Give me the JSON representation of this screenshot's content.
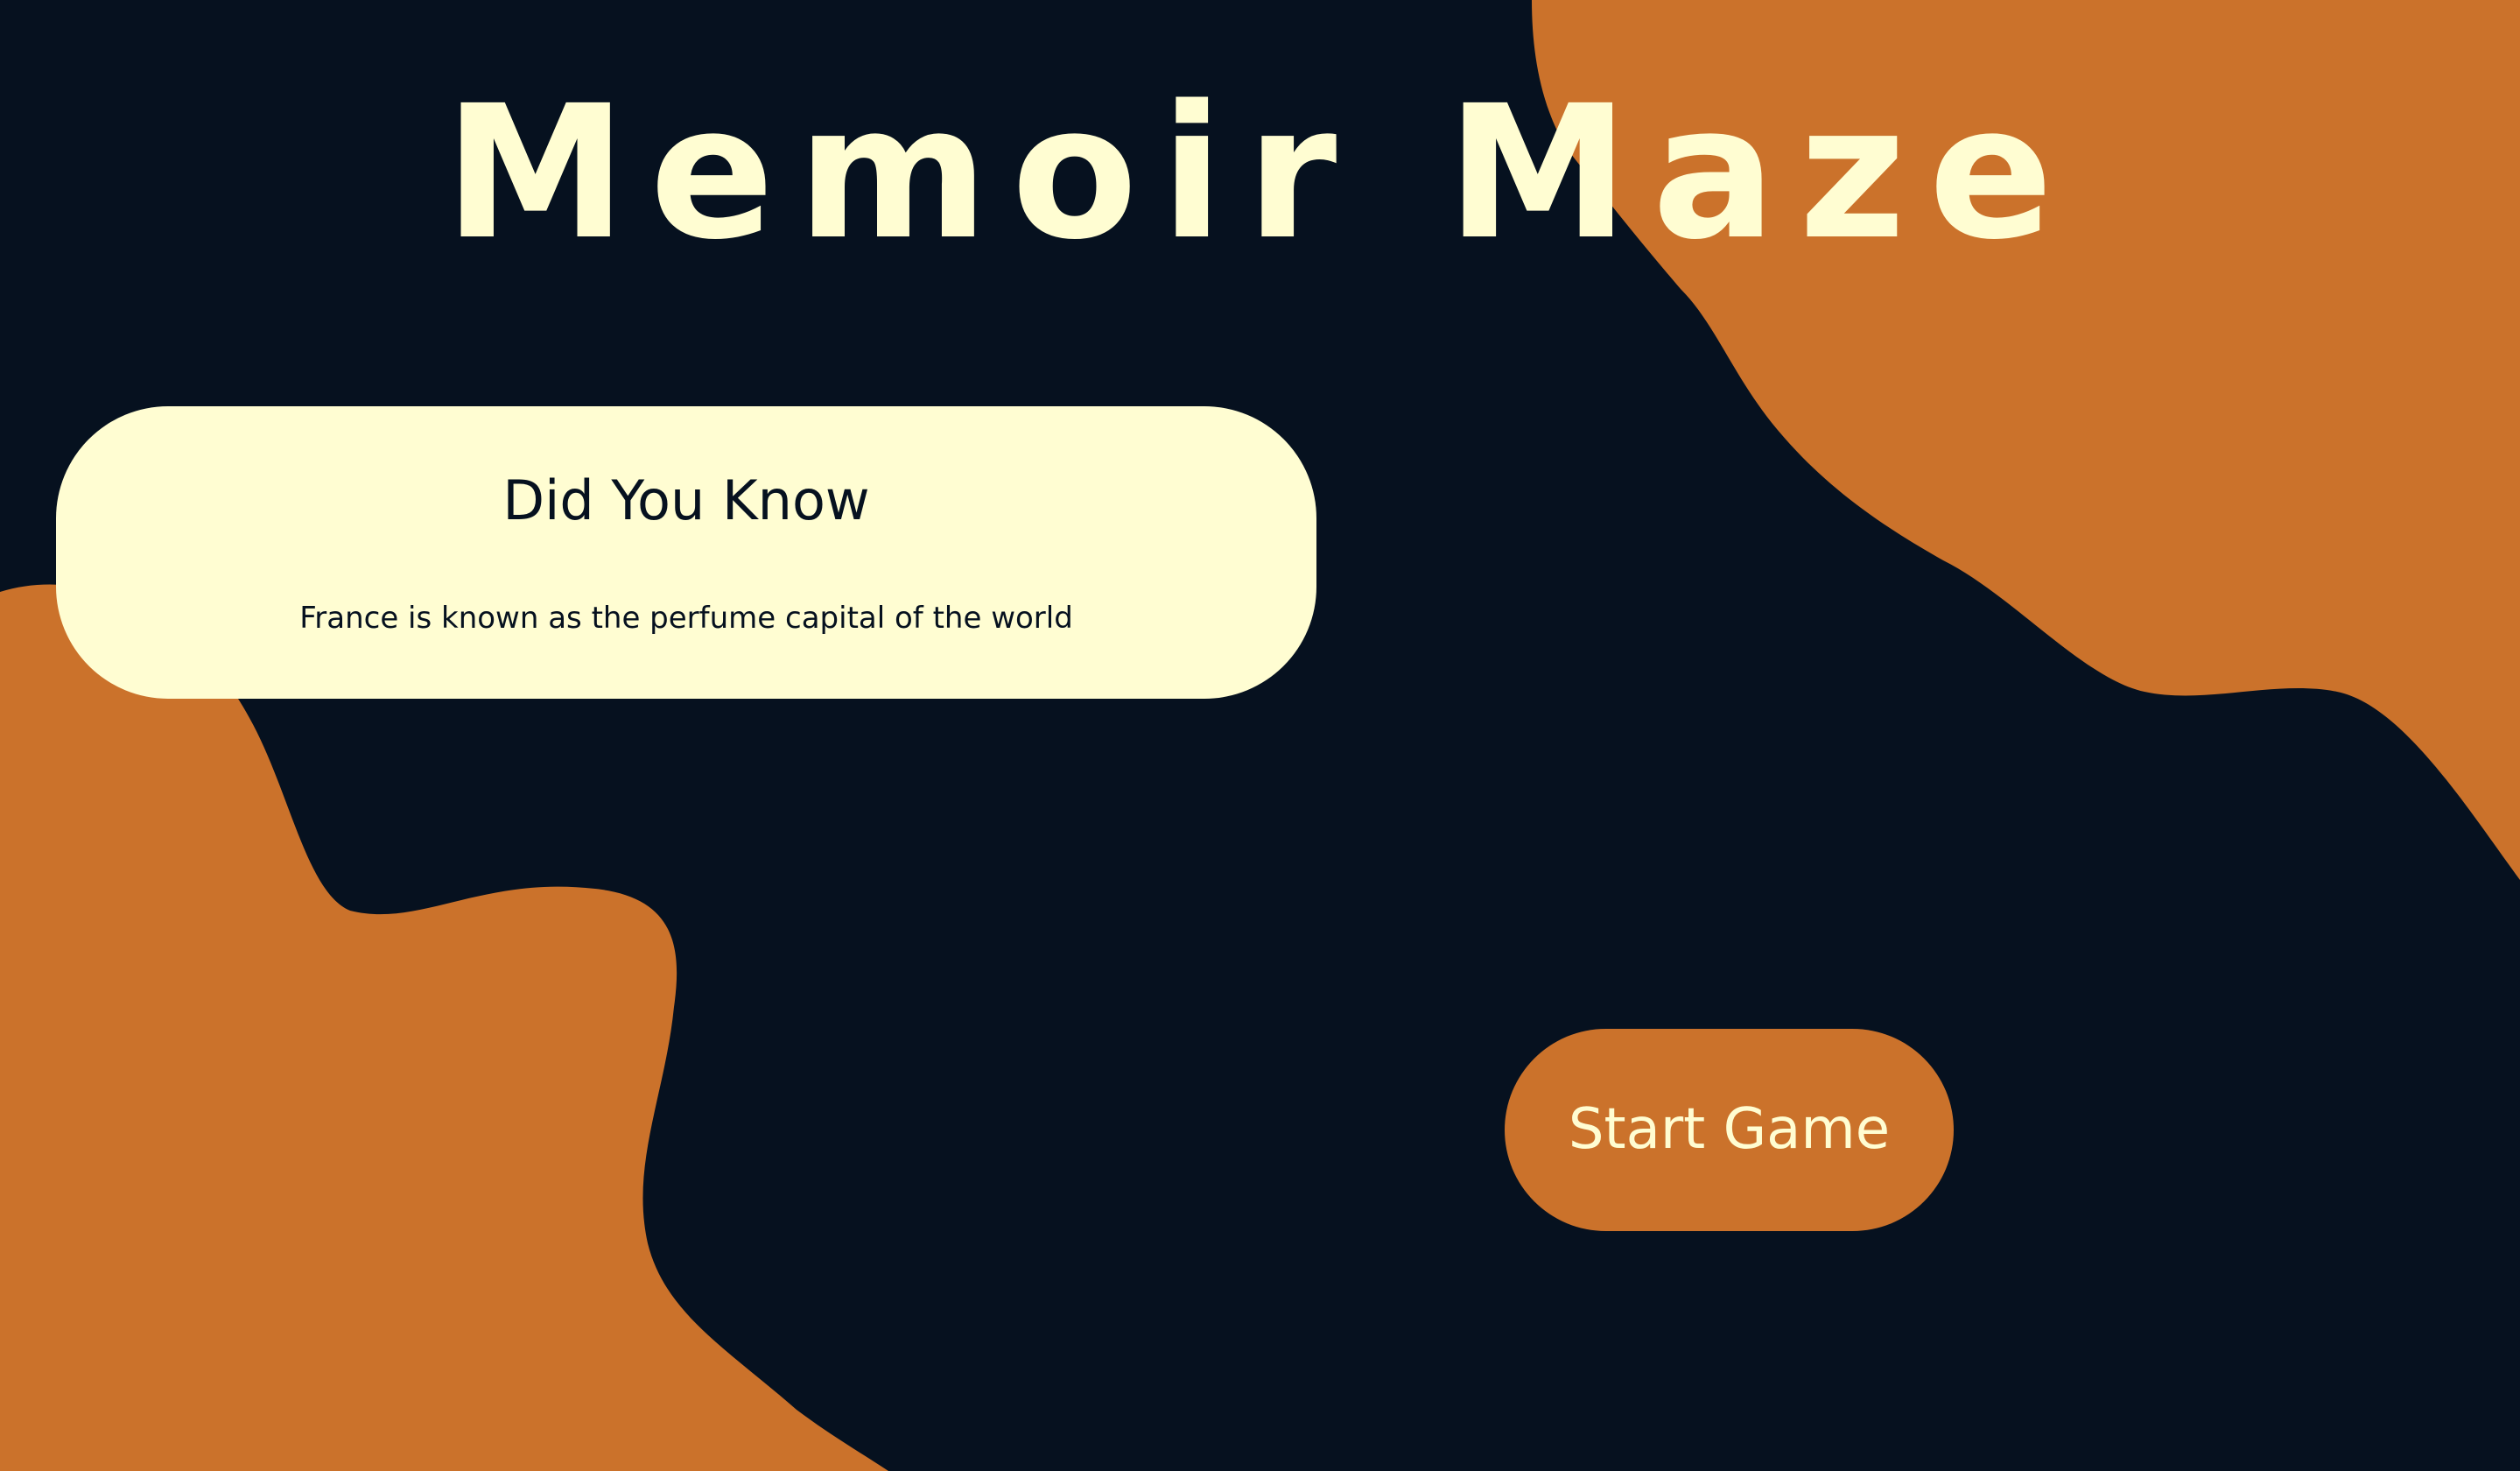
{
  "game": {
    "title": "Memoir Maze"
  },
  "fact_card": {
    "heading": "Did You Know",
    "text": "France is known as the perfume capital of the world"
  },
  "start_button": {
    "label": "Start Game"
  },
  "colors": {
    "background": "#06111f",
    "accent": "#cb722b",
    "cream": "#fffdd2"
  }
}
